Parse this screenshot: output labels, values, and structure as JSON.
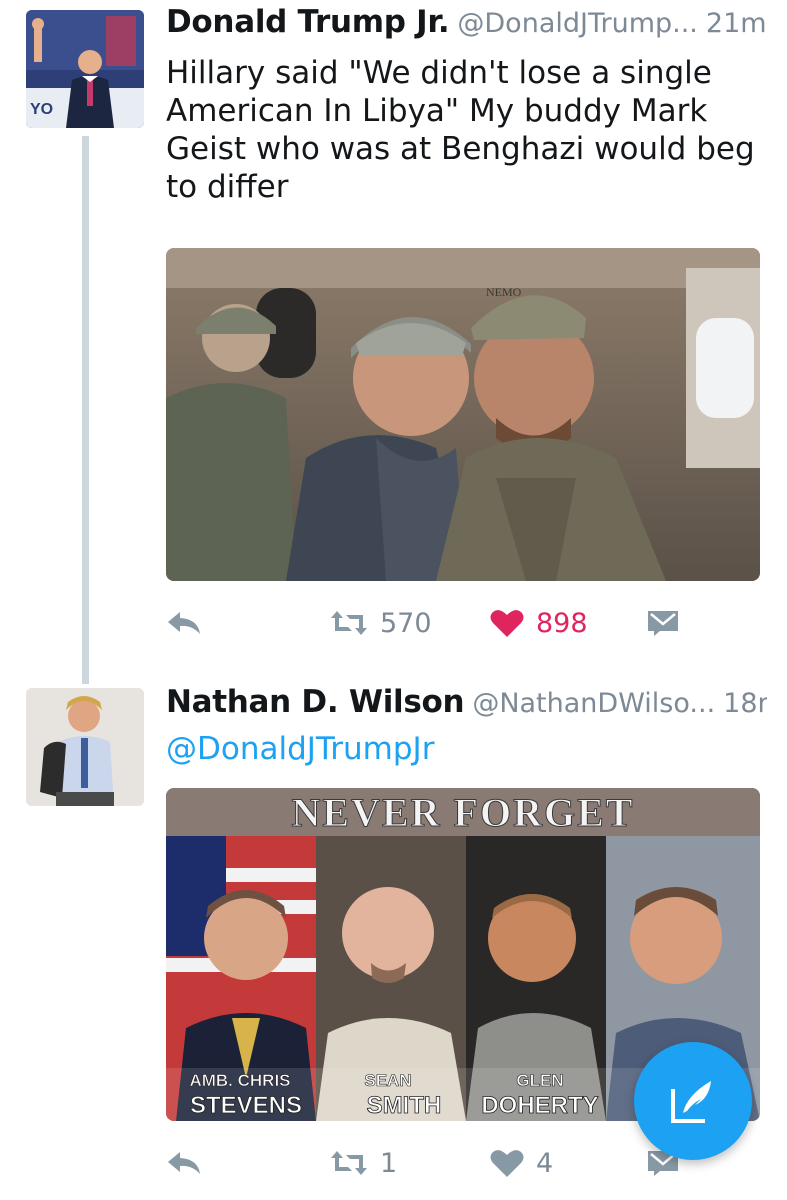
{
  "tweets": [
    {
      "name": "Donald Trump Jr.",
      "handle": "@DonaldJTrump...",
      "time": "21m",
      "text": "Hillary said \"We didn't lose a single American In Libya\" My buddy Mark Geist who was at Benghazi would beg to differ",
      "avatar_text": "YO",
      "actions": {
        "retweets": "570",
        "likes": "898",
        "liked": true
      }
    },
    {
      "name": "Nathan D. Wilson",
      "handle": "@NathanDWilso...",
      "time": "18m",
      "mention": "@DonaldJTrumpJr",
      "image_text": {
        "headline": "NEVER FORGET",
        "captions": [
          {
            "line1": "AMB. CHRIS",
            "line2": "STEVENS"
          },
          {
            "line1": "SEAN",
            "line2": "SMITH"
          },
          {
            "line1": "GLEN",
            "line2": "DOHERTY"
          }
        ]
      },
      "actions": {
        "retweets": "1",
        "likes": "4",
        "liked": false
      }
    }
  ],
  "colors": {
    "accent": "#1da1f2",
    "like": "#e0245e",
    "muted": "#7d8a96",
    "thread_line": "#ccd6dd"
  },
  "icons": [
    "reply-icon",
    "retweet-icon",
    "heart-icon",
    "direct-message-icon",
    "compose-tweet-icon"
  ]
}
